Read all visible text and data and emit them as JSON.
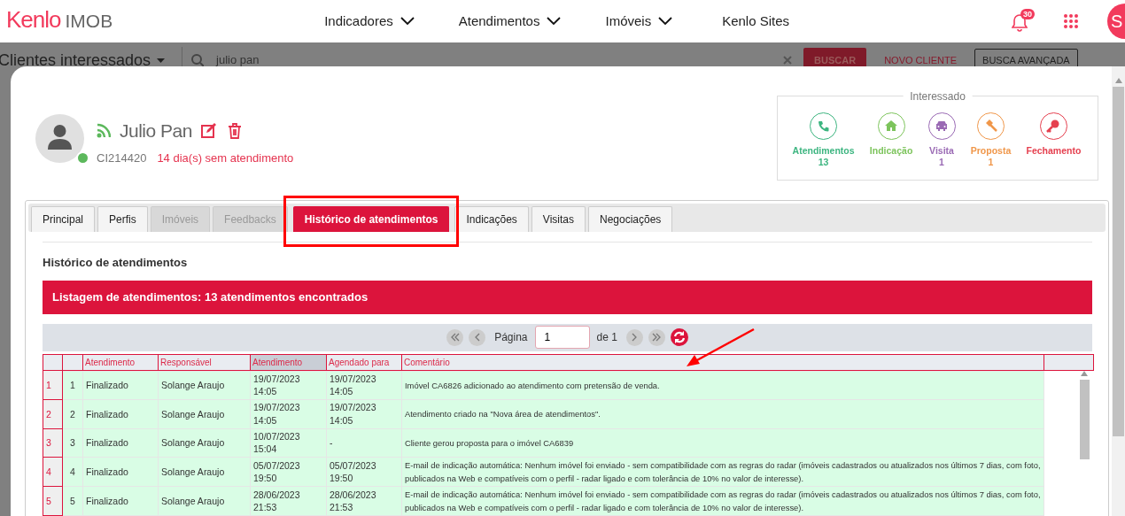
{
  "nav": {
    "logo_brand": "Kenlo",
    "logo_product": "IMOB",
    "menu": [
      {
        "label": "Indicadores",
        "dropdown": true
      },
      {
        "label": "Atendimentos",
        "dropdown": true
      },
      {
        "label": "Imóveis",
        "dropdown": true
      },
      {
        "label": "Kenlo Sites",
        "dropdown": false
      }
    ],
    "notifications": "30",
    "user_initial": "S"
  },
  "background_page": {
    "title": "Clientes interessados",
    "search_value": "julio pan",
    "search_button": "BUSCAR",
    "new_client": "NOVO CLIENTE",
    "advanced_search": "BUSCA AVANÇADA"
  },
  "client": {
    "name": "Julio Pan",
    "code": "CI214420",
    "days_without_contact": "14 dia(s) sem atendimento",
    "online": true
  },
  "interest": {
    "legend": "Interessado",
    "items": [
      {
        "label": "Atendimentos",
        "count": "13",
        "color": "#3db580"
      },
      {
        "label": "Indicação",
        "color": "#7dc45c"
      },
      {
        "label": "Visita",
        "count": "1",
        "color": "#9a6ab4"
      },
      {
        "label": "Proposta",
        "count": "1",
        "color": "#f0974a"
      },
      {
        "label": "Fechamento",
        "color": "#e5404f"
      }
    ]
  },
  "tabs": [
    {
      "label": "Principal",
      "selected": false,
      "disabled": false
    },
    {
      "label": "Perfis",
      "selected": false,
      "disabled": false
    },
    {
      "label": "Imóveis",
      "selected": false,
      "disabled": true
    },
    {
      "label": "Feedbacks",
      "selected": false,
      "disabled": true
    },
    {
      "label": "Histórico de atendimentos",
      "selected": true,
      "disabled": false
    },
    {
      "label": "Indicações",
      "selected": false,
      "disabled": false
    },
    {
      "label": "Visitas",
      "selected": false,
      "disabled": false
    },
    {
      "label": "Negociações",
      "selected": false,
      "disabled": false
    }
  ],
  "section_title": "Histórico de atendimentos",
  "list_banner": "Listagem de atendimentos: 13 atendimentos encontrados",
  "pager": {
    "page_label": "Página",
    "page_value": "1",
    "of_label": "de 1"
  },
  "table": {
    "columns": [
      {
        "label": "Atendimento",
        "sorted": false
      },
      {
        "label": "Responsável",
        "sorted": false
      },
      {
        "label": "Atendimento",
        "sorted": true
      },
      {
        "label": "Agendado para",
        "sorted": false
      },
      {
        "label": "Comentário",
        "sorted": false
      }
    ],
    "rows": [
      {
        "row_number": "1",
        "index": "1",
        "status": "Finalizado",
        "responsible": "Solange Araujo",
        "date": "19/07/2023 14:05",
        "scheduled": "19/07/2023 14:05",
        "comment": "Imóvel CA6826 adicionado ao atendimento com pretensão de venda."
      },
      {
        "row_number": "2",
        "index": "2",
        "status": "Finalizado",
        "responsible": "Solange Araujo",
        "date": "19/07/2023 14:05",
        "scheduled": "19/07/2023 14:05",
        "comment": "Atendimento criado na \"Nova área de atendimentos\"."
      },
      {
        "row_number": "3",
        "index": "3",
        "status": "Finalizado",
        "responsible": "Solange Araujo",
        "date": "10/07/2023 15:04",
        "scheduled": "-",
        "comment": "Cliente gerou proposta para o imóvel CA6839"
      },
      {
        "row_number": "4",
        "index": "4",
        "status": "Finalizado",
        "responsible": "Solange Araujo",
        "date": "05/07/2023 19:50",
        "scheduled": "05/07/2023 19:50",
        "comment": "E-mail de indicação automática: Nenhum imóvel foi enviado - sem compatibilidade com as regras do radar (imóveis cadastrados ou atualizados nos últimos 7 dias, com foto, publicados na Web e compatíveis com o perfil - radar ligado e com tolerância de 10% no valor de interesse)."
      },
      {
        "row_number": "5",
        "index": "5",
        "status": "Finalizado",
        "responsible": "Solange Araujo",
        "date": "28/06/2023 21:53",
        "scheduled": "28/06/2023 21:53",
        "comment": "E-mail de indicação automática: Nenhum imóvel foi enviado - sem compatibilidade com as regras do radar (imóveis cadastrados ou atualizados nos últimos 7 dias, com foto, publicados na Web e compatíveis com o perfil - radar ligado e com tolerância de 10% no valor de interesse)."
      }
    ]
  },
  "annotations": {
    "tab_frame": true,
    "arrow": true
  }
}
